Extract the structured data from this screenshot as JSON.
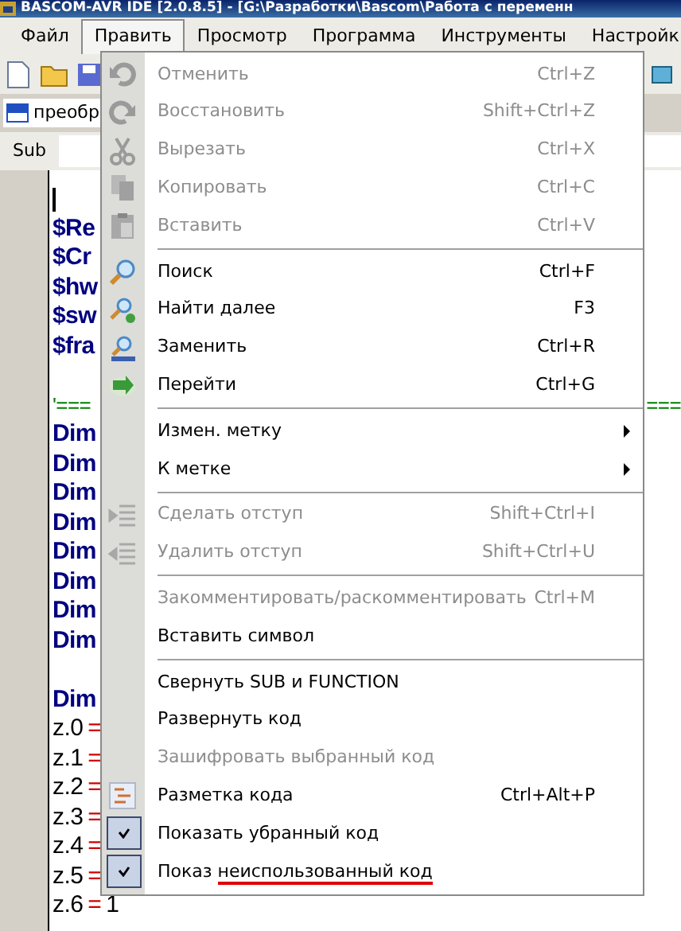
{
  "window": {
    "title": "BASCOM-AVR IDE [2.0.8.5] - [G:\\Разработки\\Bascom\\Работа с переменн"
  },
  "menu_bar": [
    {
      "label": "Файл",
      "selected": false
    },
    {
      "label": "Править",
      "selected": true
    },
    {
      "label": "Просмотр",
      "selected": false
    },
    {
      "label": "Программа",
      "selected": false
    },
    {
      "label": "Инструменты",
      "selected": false
    },
    {
      "label": "Настройк",
      "selected": false
    }
  ],
  "document_tab": {
    "label": "преобр"
  },
  "sub_bar": {
    "label": "Sub"
  },
  "editor": {
    "lines": [
      {
        "kind": "cursor"
      },
      {
        "kind": "code",
        "left": [
          {
            "text": "$Re",
            "kind": "directive"
          }
        ]
      },
      {
        "kind": "code",
        "left": [
          {
            "text": "$Cr",
            "kind": "directive"
          }
        ]
      },
      {
        "kind": "code",
        "left": [
          {
            "text": "$hw",
            "kind": "directive"
          }
        ]
      },
      {
        "kind": "code",
        "left": [
          {
            "text": "$sw",
            "kind": "directive"
          }
        ]
      },
      {
        "kind": "code",
        "left": [
          {
            "text": "$fra",
            "kind": "directive"
          }
        ]
      },
      {
        "kind": "blank"
      },
      {
        "kind": "code",
        "left": [
          {
            "text": "'===",
            "kind": "comment"
          }
        ],
        "right": [
          {
            "text": "===",
            "kind": "comment"
          }
        ]
      },
      {
        "kind": "code",
        "left": [
          {
            "text": "Dim",
            "kind": "keyword"
          }
        ]
      },
      {
        "kind": "code",
        "left": [
          {
            "text": "Dim",
            "kind": "keyword"
          }
        ]
      },
      {
        "kind": "code",
        "left": [
          {
            "text": "Dim",
            "kind": "keyword"
          }
        ]
      },
      {
        "kind": "code",
        "left": [
          {
            "text": "Dim",
            "kind": "keyword"
          }
        ]
      },
      {
        "kind": "code",
        "left": [
          {
            "text": "Dim",
            "kind": "keyword"
          }
        ]
      },
      {
        "kind": "code",
        "left": [
          {
            "text": "Dim",
            "kind": "keyword"
          }
        ]
      },
      {
        "kind": "code",
        "left": [
          {
            "text": "Dim",
            "kind": "keyword"
          }
        ]
      },
      {
        "kind": "code",
        "left": [
          {
            "text": "Dim",
            "kind": "keyword"
          }
        ]
      },
      {
        "kind": "blank"
      },
      {
        "kind": "code",
        "left": [
          {
            "text": "Dim",
            "kind": "keyword"
          }
        ]
      },
      {
        "kind": "code",
        "left": [
          {
            "text": "z.0",
            "kind": "variable"
          },
          {
            "text": "=",
            "kind": "operator"
          }
        ]
      },
      {
        "kind": "code",
        "left": [
          {
            "text": "z.1",
            "kind": "variable"
          },
          {
            "text": "=",
            "kind": "operator"
          }
        ]
      },
      {
        "kind": "code",
        "left": [
          {
            "text": "z.2",
            "kind": "variable"
          },
          {
            "text": "=",
            "kind": "operator"
          }
        ]
      },
      {
        "kind": "code",
        "left": [
          {
            "text": "z.3",
            "kind": "variable"
          },
          {
            "text": "=",
            "kind": "operator"
          }
        ]
      },
      {
        "kind": "code",
        "left": [
          {
            "text": "z.4",
            "kind": "variable"
          },
          {
            "text": "=",
            "kind": "operator"
          }
        ]
      },
      {
        "kind": "code",
        "left": [
          {
            "text": "z.5",
            "kind": "variable"
          },
          {
            "text": "=",
            "kind": "operator"
          }
        ]
      },
      {
        "kind": "code",
        "left": [
          {
            "text": "z.6",
            "kind": "variable"
          },
          {
            "text": "=",
            "kind": "operator"
          },
          {
            "text": "1",
            "kind": "number"
          }
        ]
      }
    ]
  },
  "edit_menu": {
    "items": [
      {
        "kind": "item",
        "label": "Отменить",
        "shortcut": "Ctrl+Z",
        "disabled": true,
        "checked": false,
        "has_submenu": false
      },
      {
        "kind": "item",
        "label": "Восстановить",
        "shortcut": "Shift+Ctrl+Z",
        "disabled": true,
        "checked": false,
        "has_submenu": false
      },
      {
        "kind": "item",
        "label": "Вырезать",
        "shortcut": "Ctrl+X",
        "disabled": true,
        "checked": false,
        "has_submenu": false
      },
      {
        "kind": "item",
        "label": "Копировать",
        "shortcut": "Ctrl+C",
        "disabled": true,
        "checked": false,
        "has_submenu": false
      },
      {
        "kind": "item",
        "label": "Вставить",
        "shortcut": "Ctrl+V",
        "disabled": true,
        "checked": false,
        "has_submenu": false
      },
      {
        "kind": "separator"
      },
      {
        "kind": "item",
        "label": "Поиск",
        "shortcut": "Ctrl+F",
        "disabled": false,
        "checked": false,
        "has_submenu": false
      },
      {
        "kind": "item",
        "label": "Найти далее",
        "shortcut": "F3",
        "disabled": false,
        "checked": false,
        "has_submenu": false
      },
      {
        "kind": "item",
        "label": "Заменить",
        "shortcut": "Ctrl+R",
        "disabled": false,
        "checked": false,
        "has_submenu": false
      },
      {
        "kind": "item",
        "label": "Перейти",
        "shortcut": "Ctrl+G",
        "disabled": false,
        "checked": false,
        "has_submenu": false
      },
      {
        "kind": "separator"
      },
      {
        "kind": "item",
        "label": "Измен. метку",
        "disabled": false,
        "checked": false,
        "has_submenu": true
      },
      {
        "kind": "item",
        "label": "К метке",
        "disabled": false,
        "checked": false,
        "has_submenu": true
      },
      {
        "kind": "separator"
      },
      {
        "kind": "item",
        "label": "Сделать отступ",
        "shortcut": "Shift+Ctrl+I",
        "disabled": true,
        "checked": false,
        "has_submenu": false
      },
      {
        "kind": "item",
        "label": "Удалить отступ",
        "shortcut": "Shift+Ctrl+U",
        "disabled": true,
        "checked": false,
        "has_submenu": false
      },
      {
        "kind": "separator"
      },
      {
        "kind": "item",
        "label": "Закомментировать/раскомментировать",
        "shortcut": "Ctrl+M",
        "disabled": true,
        "checked": false,
        "has_submenu": false
      },
      {
        "kind": "item",
        "label": "Вставить символ",
        "disabled": false,
        "checked": false,
        "has_submenu": false
      },
      {
        "kind": "separator"
      },
      {
        "kind": "item",
        "label": "Свернуть SUB и FUNCTION",
        "disabled": false,
        "checked": false,
        "has_submenu": false
      },
      {
        "kind": "item",
        "label": "Развернуть код",
        "disabled": false,
        "checked": false,
        "has_submenu": false
      },
      {
        "kind": "item",
        "label": "Зашифровать выбранный код",
        "disabled": true,
        "checked": false,
        "has_submenu": false
      },
      {
        "kind": "item",
        "label": "Разметка кода",
        "shortcut": "Ctrl+Alt+P",
        "disabled": false,
        "checked": false,
        "has_submenu": false
      },
      {
        "kind": "item",
        "label": "Показать убранный код",
        "disabled": false,
        "checked": true,
        "has_submenu": false
      },
      {
        "kind": "item",
        "label": "Показ",
        "underlined_part": "неиспользованный код",
        "disabled": false,
        "checked": true,
        "has_submenu": false
      }
    ]
  }
}
